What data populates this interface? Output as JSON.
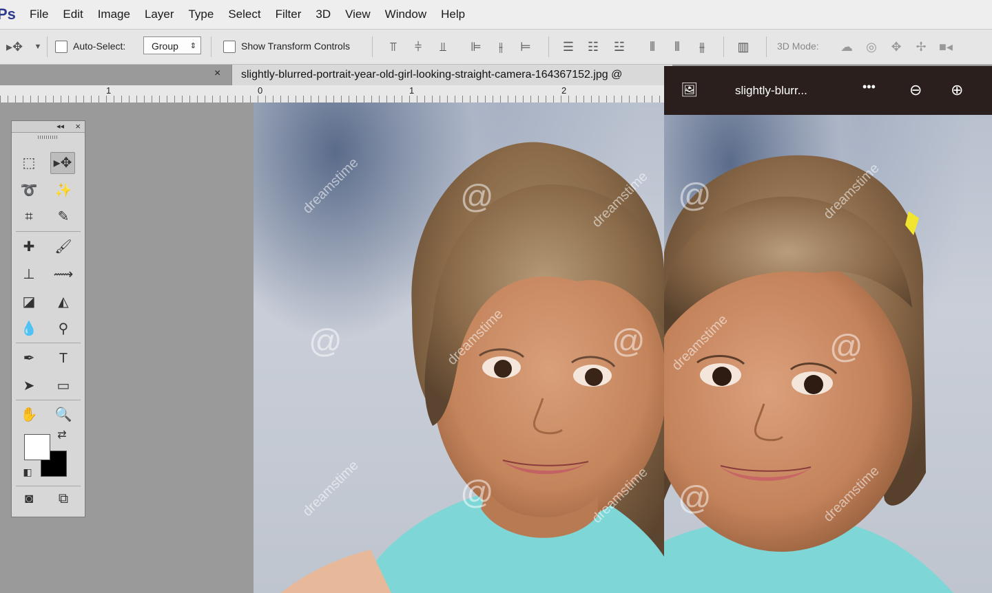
{
  "menubar": {
    "logo": "Ps",
    "items": [
      "File",
      "Edit",
      "Image",
      "Layer",
      "Type",
      "Select",
      "Filter",
      "3D",
      "View",
      "Window",
      "Help"
    ]
  },
  "options": {
    "auto_select_label": "Auto-Select:",
    "auto_select_value": "Group",
    "show_transform_label": "Show Transform Controls",
    "mode_3d_label": "3D Mode:"
  },
  "document": {
    "tab_close": "×",
    "tab_title": "slightly-blurred-portrait-year-old-girl-looking-straight-camera-164367152.jpg @"
  },
  "ruler": {
    "labels": [
      "1",
      "0",
      "1",
      "2"
    ]
  },
  "viewer": {
    "title": "slightly-blurr...",
    "more": "•••"
  },
  "watermark": "dreamstime",
  "colors": {
    "menubar_bg": "#eeeeee",
    "viewer_header_bg": "#2b1f1e",
    "ps_logo": "#2d3b8e"
  }
}
